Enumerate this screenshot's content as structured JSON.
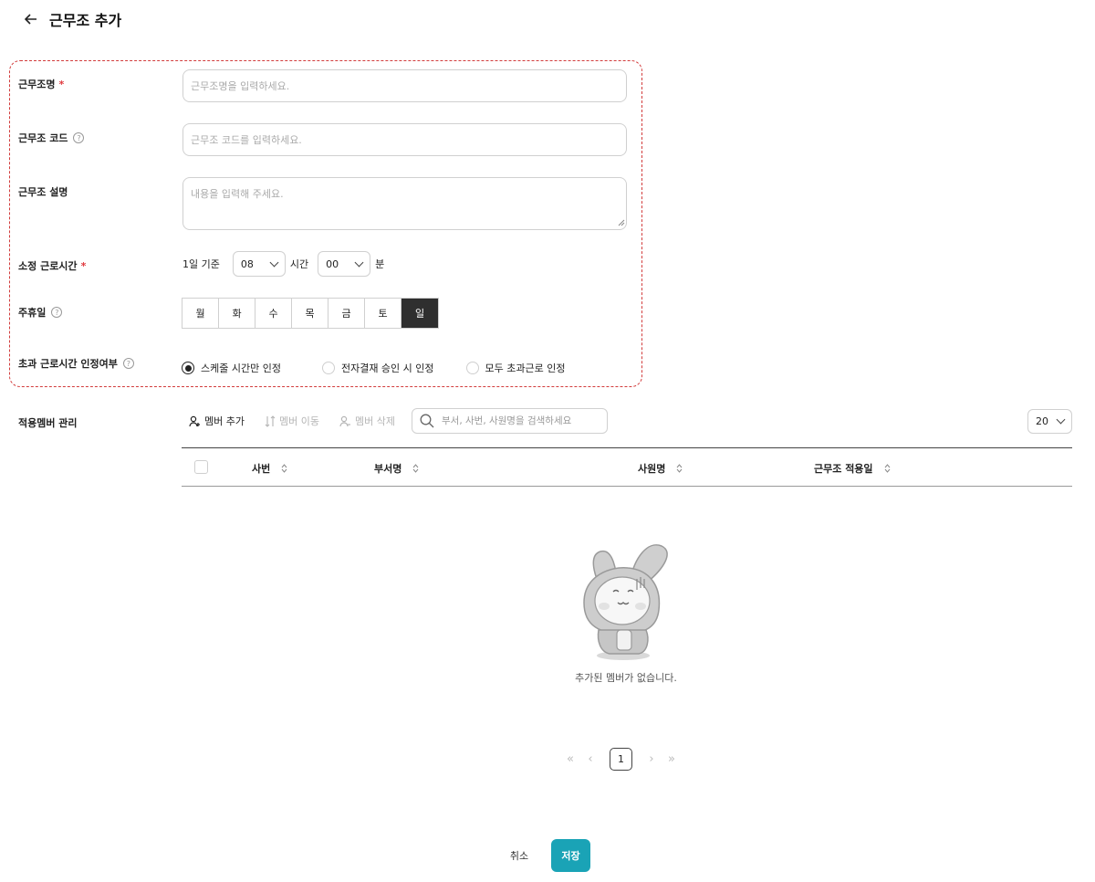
{
  "header": {
    "title": "근무조 추가"
  },
  "form": {
    "name": {
      "label": "근무조명",
      "required": "*",
      "placeholder": "근무조명을 입력하세요."
    },
    "code": {
      "label": "근무조 코드",
      "placeholder": "근무조 코드를 입력하세요."
    },
    "description": {
      "label": "근무조 설명",
      "placeholder": "내용을 입력해 주세요."
    },
    "hours": {
      "label": "소정 근로시간",
      "required": "*",
      "prefix": "1일 기준",
      "hour_value": "08",
      "hour_unit": "시간",
      "minute_value": "00",
      "minute_unit": "분"
    },
    "weekly_holiday": {
      "label": "주휴일",
      "days": [
        "월",
        "화",
        "수",
        "목",
        "금",
        "토",
        "일"
      ],
      "selected": "일"
    },
    "overtime": {
      "label": "초과 근로시간 인정여부",
      "options": [
        "스케줄 시간만 인정",
        "전자결재 승인 시 인정",
        "모두 초과근로 인정"
      ],
      "selected_index": 0
    }
  },
  "members": {
    "label": "적용멤버 관리",
    "add_label": "멤버 추가",
    "move_label": "멤버 이동",
    "delete_label": "멤버 삭제",
    "search_placeholder": "부서, 사번, 사원명을 검색하세요",
    "page_size": "20",
    "columns": [
      "사번",
      "부서명",
      "사원명",
      "근무조 적용일"
    ],
    "empty_message": "추가된 멤버가 없습니다.",
    "current_page": "1"
  },
  "footer": {
    "cancel_label": "취소",
    "save_label": "저장"
  },
  "colors": {
    "accent": "#1aa3b6",
    "required": "#e0393e",
    "form_outline": "#d23c3c",
    "selected_day": "#2f2f2f"
  }
}
